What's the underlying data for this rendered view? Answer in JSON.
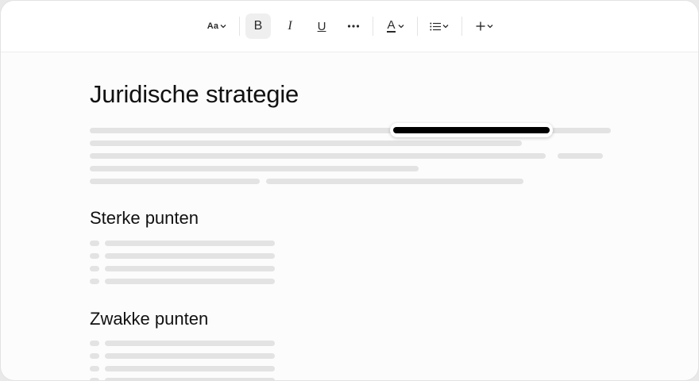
{
  "document": {
    "title": "Juridische strategie",
    "sections": [
      {
        "heading": "Sterke punten"
      },
      {
        "heading": "Zwakke punten"
      }
    ]
  },
  "toolbar": {
    "items": [
      {
        "icon": "text-style-icon",
        "label": "Aa",
        "has_dropdown": true
      },
      {
        "icon": "bold-icon",
        "label": "B",
        "active": true
      },
      {
        "icon": "italic-icon",
        "label": "I"
      },
      {
        "icon": "underline-icon",
        "label": "U"
      },
      {
        "icon": "more-icon"
      },
      {
        "icon": "text-color-icon",
        "label": "A",
        "has_dropdown": true
      },
      {
        "icon": "list-icon",
        "has_dropdown": true
      },
      {
        "icon": "add-icon",
        "has_dropdown": true
      }
    ]
  },
  "colors": {
    "background": "#fcfcfc",
    "placeholder": "#e3e3e3",
    "active_button": "#efefef",
    "selection": "#000000",
    "text": "#111111"
  }
}
